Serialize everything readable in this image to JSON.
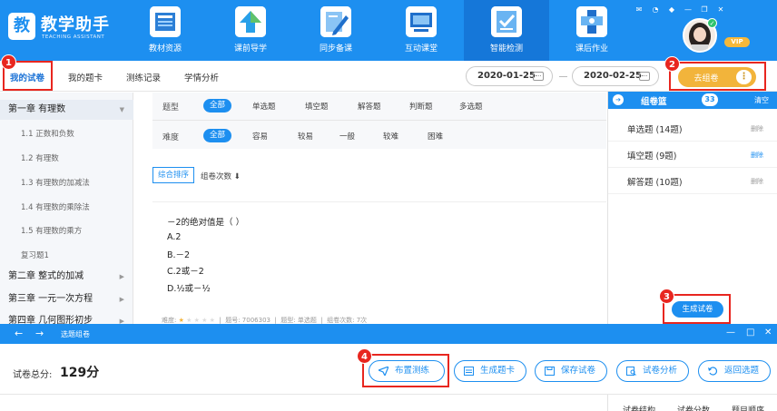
{
  "app": {
    "logo_char": "教",
    "title": "教学助手",
    "subtitle": "TEACHING ASSISTANT",
    "vip": "VIP"
  },
  "nav": [
    {
      "label": "教材资源",
      "icon": "book-icon"
    },
    {
      "label": "课前导学",
      "icon": "up-arrow-icon"
    },
    {
      "label": "同步备课",
      "icon": "pencil-icon"
    },
    {
      "label": "互动课堂",
      "icon": "screen-icon"
    },
    {
      "label": "智能检测",
      "icon": "checklist-icon",
      "active": true
    },
    {
      "label": "课后作业",
      "icon": "homework-icon"
    }
  ],
  "tabs": [
    {
      "label": "我的试卷",
      "active": true
    },
    {
      "label": "我的题卡"
    },
    {
      "label": "测练记录"
    },
    {
      "label": "学情分析"
    }
  ],
  "date_from": "2020-01-25",
  "date_to": "2020-02-25",
  "go_button": "去组卷",
  "more": "⋮",
  "badges": [
    "1",
    "2",
    "3",
    "4"
  ],
  "sidebar": {
    "chapter1": "第一章 有理数",
    "sections": [
      "1.1 正数和负数",
      "1.2 有理数",
      "1.3 有理数的加减法",
      "1.4 有理数的乘除法",
      "1.5 有理数的乘方",
      "复习题1"
    ],
    "chapter2": "第二章 整式的加减",
    "chapter3": "第三章 一元一次方程",
    "chapter4": "第四章 几何图形初步"
  },
  "filters": {
    "type_label": "题型",
    "types": [
      "全部",
      "单选题",
      "填空题",
      "解答题",
      "判断题",
      "多选题"
    ],
    "diff_label": "难度",
    "diffs": [
      "全部",
      "容易",
      "较易",
      "一般",
      "较难",
      "困难"
    ]
  },
  "sort": {
    "primary": "综合排序",
    "secondary": "组卷次数 ⬇"
  },
  "question": {
    "stem": "－2的绝对值是（ ）",
    "options": [
      "A.2",
      "B.－2",
      "C.2或－2",
      "D.½或－½"
    ],
    "meta_difficulty": "难度:",
    "meta_id": "题号: 7006303",
    "meta_type": "题型: 单选题",
    "meta_count": "组卷次数: 7次",
    "stars": 1,
    "stars_total": 5
  },
  "basket": {
    "title": "组卷篮",
    "count": "33",
    "clear": "清空",
    "rows": [
      {
        "label": "单选题 (14题)",
        "del": "删除"
      },
      {
        "label": "填空题 (9题)",
        "del": "删除"
      },
      {
        "label": "解答题 (10题)",
        "del": "删除"
      }
    ],
    "generate": "生成试卷"
  },
  "subwindow": {
    "title": "选题组卷",
    "min": "—",
    "max": "□",
    "close": "✕"
  },
  "bottom": {
    "total_label": "试卷总分:",
    "total_value": "129分",
    "buttons": [
      "布置测练",
      "生成题卡",
      "保存试卷",
      "试卷分析",
      "返回选题"
    ]
  },
  "footer_tabs": [
    "试卷结构",
    "试卷分数",
    "题目顺序"
  ],
  "colors": {
    "primary": "#1d8ff0",
    "accent": "#f2b43b",
    "highlight": "#e8261f"
  }
}
